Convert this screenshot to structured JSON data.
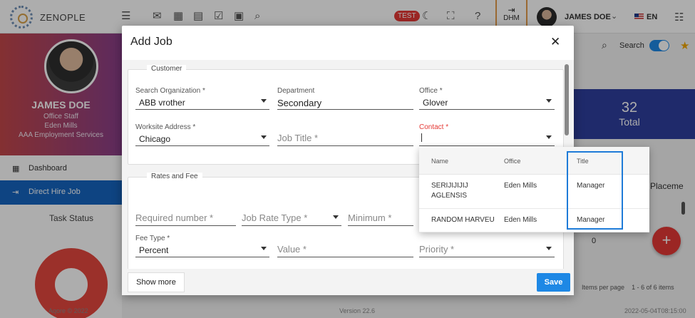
{
  "app": {
    "brand": "ZENOPLE",
    "test_badge": "TEST",
    "dhm_label": "DHM",
    "user_name": "JAMES DOE",
    "language": "EN"
  },
  "icons": [
    "hamburger-icon",
    "mail-icon",
    "calculator-icon",
    "chat-icon",
    "checkbox-icon",
    "calendar-icon",
    "search-icon",
    "moon-icon",
    "fullscreen-icon",
    "help-icon",
    "login-icon",
    "list-menu-icon",
    "star-icon",
    "plus-icon",
    "close-icon"
  ],
  "profile": {
    "name": "JAMES DOE",
    "role": "Office Staff",
    "office": "Eden Mills",
    "company": "AAA Employment Services"
  },
  "sidebar": {
    "items": [
      {
        "label": "Dashboard",
        "icon": "dashboard-icon"
      },
      {
        "label": "Direct Hire Job",
        "icon": "login-icon",
        "active": true
      }
    ],
    "task_status": "Task Status"
  },
  "background": {
    "search_label": "Search",
    "stat_value": "32",
    "stat_label": "Total",
    "placement_header": "Placeme",
    "cell_value": "0",
    "items_per_page": "Items per page",
    "range": "1 - 6 of 6 items",
    "footer_left": "Aqore © 2022",
    "footer_center": "Version 22.6",
    "footer_right": "2022-05-04T08:15:00"
  },
  "modal": {
    "title": "Add Job",
    "customer_section": "Customer",
    "rates_section": "Rates and Fee",
    "fields": {
      "search_org": {
        "label": "Search Organization *",
        "value": "ABB vrother"
      },
      "department": {
        "label": "Department",
        "value": "Secondary"
      },
      "office": {
        "label": "Office *",
        "value": "Glover"
      },
      "worksite": {
        "label": "Worksite Address *",
        "value": "Chicago"
      },
      "job_title": {
        "placeholder": "Job Title *"
      },
      "contact": {
        "label": "Contact *",
        "value": ""
      },
      "required_number": {
        "placeholder": "Required number *"
      },
      "job_rate_type": {
        "placeholder": "Job Rate Type *"
      },
      "minimum": {
        "placeholder": "Minimum *"
      },
      "fee_type": {
        "label": "Fee Type *",
        "value": "Percent"
      },
      "value": {
        "placeholder": "Value *"
      },
      "priority": {
        "placeholder": "Priority *"
      }
    },
    "show_more": "Show more",
    "save": "Save"
  },
  "contact_dropdown": {
    "columns": [
      "Name",
      "Office",
      "Title"
    ],
    "rows": [
      {
        "name_line1": "SERIJIJIJIJ",
        "name_line2": "AGLENSIS",
        "office": "Eden Mills",
        "title": "Manager"
      },
      {
        "name_line1": "RANDOM HARVEU",
        "name_line2": "",
        "office": "Eden Mills",
        "title": "Manager"
      }
    ]
  },
  "colors": {
    "primary": "#1e88e5",
    "active_nav": "#1565c0",
    "danger": "#e53935",
    "stat_card": "#2f3e9e",
    "highlight": "#1e7bd8"
  }
}
